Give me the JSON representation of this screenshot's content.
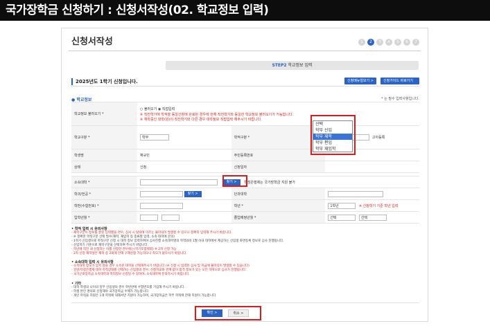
{
  "header": {
    "title": "국가장학금 신청하기 : 신청서작성(02. 학교정보 입력)"
  },
  "page": {
    "title": "신청서작성"
  },
  "steps": [
    "1",
    "2",
    "3",
    "4",
    "5",
    "6",
    "7"
  ],
  "active_step": 2,
  "step_bar": {
    "step": "STEP2",
    "label": "학교정보 입력"
  },
  "semester": {
    "text": "2025년도 1학기 신청입니다.",
    "btn_manual": "신청매뉴얼보기 >",
    "btn_guide": "신청가이드 바로가기 >"
  },
  "section": {
    "title": "학교정보",
    "required_note": "* 는 필수 입력사항입니다."
  },
  "form": {
    "load_label": "학교정보 불러오기 *",
    "radio_load": "불러오기",
    "radio_direct": "직접입력",
    "load_note1": "※ 직전학기에 학적을 동일신청에 완료된 경우에 한해 직전학기와 동일한 학교정보 불러오기가 가능합니다.",
    "load_note2": "※ 재학중인 대학(원)이 직전학기와 다른 경우 대학정보 직접입력 해주시기 바랍니다.",
    "school_type_label": "학교구분 *",
    "school_type_value": "학부",
    "enroll_label": "학적구분 *",
    "enroll_hint": "고아등록",
    "student_name_label": "학생명",
    "student_name_value": "채규민",
    "resident_label": "주민등록번호",
    "status_label": "상태",
    "status_value": "신청",
    "apply_date_label": "신청일자",
    "univ_label": "소속대학 *",
    "find_btn": "찾기 >",
    "univ_note": "학점은행제는 국가장학금 지원 불가",
    "dept_label": "학과/전공 *",
    "find_btn2": "찾기 >",
    "college_label": "단과대학",
    "student_no_label": "학번(수험번호) *",
    "grade_label": "학년 *",
    "grade_value": "1학년",
    "grade_note": "※ 신청학기 기준 학년 입력",
    "admit_label": "입학년월 *",
    "grad_label": "졸업예정년월 *",
    "grad_sel1": "선택",
    "grad_sel2": "선택"
  },
  "dropdown": {
    "options": [
      "선택",
      "학부 신입",
      "학부 재학",
      "학부 편입",
      "학부 재입학"
    ],
    "selected": 2
  },
  "notes": {
    "h1": "• 학적 입력 시 유의사항",
    "l1": "- 재학구분이 정보를 잘못 입력했을 경우, 심사 시 탈락에 이르는 불이익이 발생할 수 있으니 정확히 입력해 주시기 바랍니다.",
    "l2": "- ※ 정확한 학적구분 선택 필수(재학, 재입학 등 종류별 입력, 소속 대학에 문의)",
    "l3": "- 1학기 신입생으로 학적구분 신청 시 대학 정보 입력하여야 심사진행 소속대학명의 학적와의 1월 이내 대학에서 제공하는 신입생 화면등록 정보로 심사 진행됩니다.",
    "l4": "- 신입학기 기준으로 재학구분을 선택하여 주시기 바랍니다.",
    "l5": "- 학년에 적힌 내 신청하는 이를 신청한 경우에는(학기포함제외) ※ 2차 신청 가능",
    "l6": "- 2차 신청 재학생은 재학 중 2회에 한해 구제신청 가능하오니 착오가 없으시기 바랍니다.",
    "h2": "• 소속대학 입력 시 유의사항",
    "m1": "- 소속대학 정보가 맞지 않을 경우 소속된 대학을 선택해주시기 바랍니다 (※ 신청 시 입력된 심사 및 지급에 불이익이 발생할 수 있습니다)",
    "m2": "- 일반/학점은행제 대학 학적상태를 선택하는 신입생의 경우, 신청학교와 관계 없이 합격 정보가 있는 모든 대학으로 심사가 진행됩니다.",
    "m3": "- 국가근로장학금 소속대학과 학적정보 신청일 수 있어야, 소속대학에 문의하시기 바랍니다.",
    "h3": "• 기타",
    "o1": "- 대학 학생의 나이의 일부 신입생의 경우 학번란에 수험번호를 기입해 주시기 바랍니다.",
    "o2": "- 학생 본인 명의로 신청해야 국가장학금 수혜가 가능합니다.",
    "o3": "- 개인 학적을 지원은 1개 학적에 대해서만 지원이 가능하며, 국가장학금은 학부 학적에 한해 지원이 가능합니다."
  },
  "footer": {
    "confirm": "확인 >",
    "cancel": "취소 >"
  }
}
